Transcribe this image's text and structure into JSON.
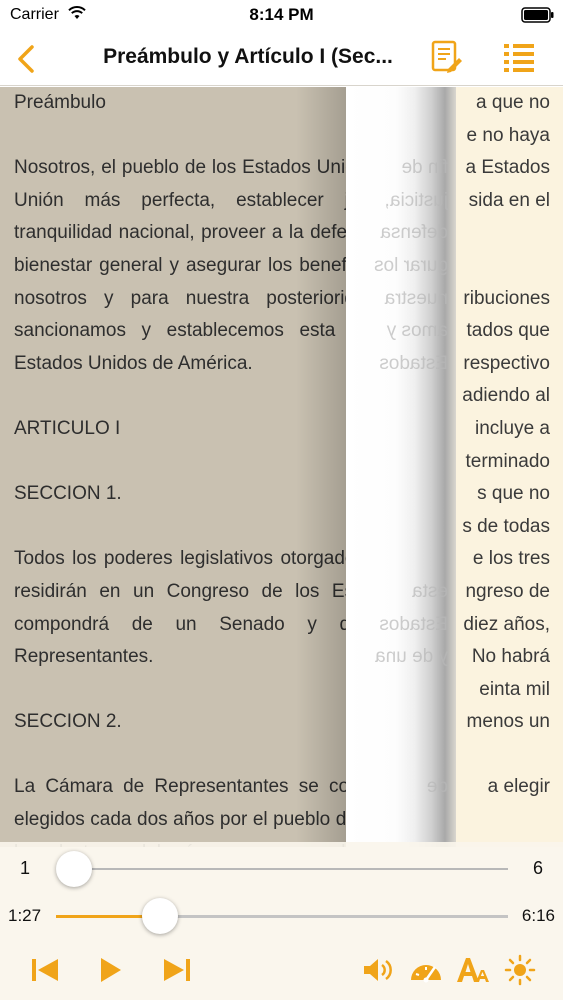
{
  "status_bar": {
    "carrier": "Carrier",
    "time": "8:14 PM"
  },
  "nav": {
    "title": "Preámbulo y Artículo I (Sec..."
  },
  "page_left": {
    "paragraphs": [
      "Preámbulo",
      "",
      "Nosotros, el pueblo de los Estados Unidos, a fin de formar una Unión más perfecta, establecer justicia, garantizar la tranquilidad nacional, proveer a la defensa común, fomentar el bienestar general y asegurar los beneficios de la libertad para nosotros y para nuestra posterioridad, por la presente sancionamos y establecemos esta Constitución para los Estados Unidos de América.",
      "",
      "ARTICULO I",
      "",
      "SECCION 1.",
      "",
      "Todos los poderes legislativos otorgados en esta Constitución residirán en un Congreso de los Estados Unidos que se compondrá de un Senado y de una Cámara de Representantes.",
      "",
      "SECCION 2.",
      "",
      "La Cámara de Representantes se compondrá de miembros elegidos cada dos años por el pueblo de los distintos estados y los electores deberán poseer en cada estado los requisitos exigidos a los electores"
    ]
  },
  "page_right_lines": [
    "a que no",
    "e no haya",
    "a Estados",
    "sida en el",
    "",
    "",
    "ribuciones",
    "tados que",
    "respectivo",
    "adiendo al",
    "incluye a",
    "terminado",
    "s que no",
    "s de todas",
    "e los tres",
    "ngreso de",
    "diez años,",
    "No habrá",
    "einta mil",
    "menos un",
    "",
    "a elegir"
  ],
  "curl_lines": [
    "",
    "",
    "fin de",
    "justicia,",
    "defensa",
    "gurar los",
    "nuestra",
    "amos y",
    "Estados",
    "",
    "",
    "",
    "",
    "",
    "",
    "esta",
    "Estados",
    "y de una",
    "",
    "",
    "",
    "de"
  ],
  "controls": {
    "page_start": "1",
    "page_end": "6",
    "page_progress": 0.0,
    "time_current": "1:27",
    "time_total": "6:16",
    "time_progress": 0.23
  },
  "colors": {
    "accent": "#f0a419"
  },
  "icons": {
    "back": "chevron-left-icon",
    "notes": "notes-icon",
    "toc": "list-icon",
    "prev": "skip-back-icon",
    "play": "play-icon",
    "next": "skip-forward-icon",
    "volume": "speaker-icon",
    "speed": "speedometer-icon",
    "font": "font-size-icon",
    "brightness": "brightness-icon"
  }
}
